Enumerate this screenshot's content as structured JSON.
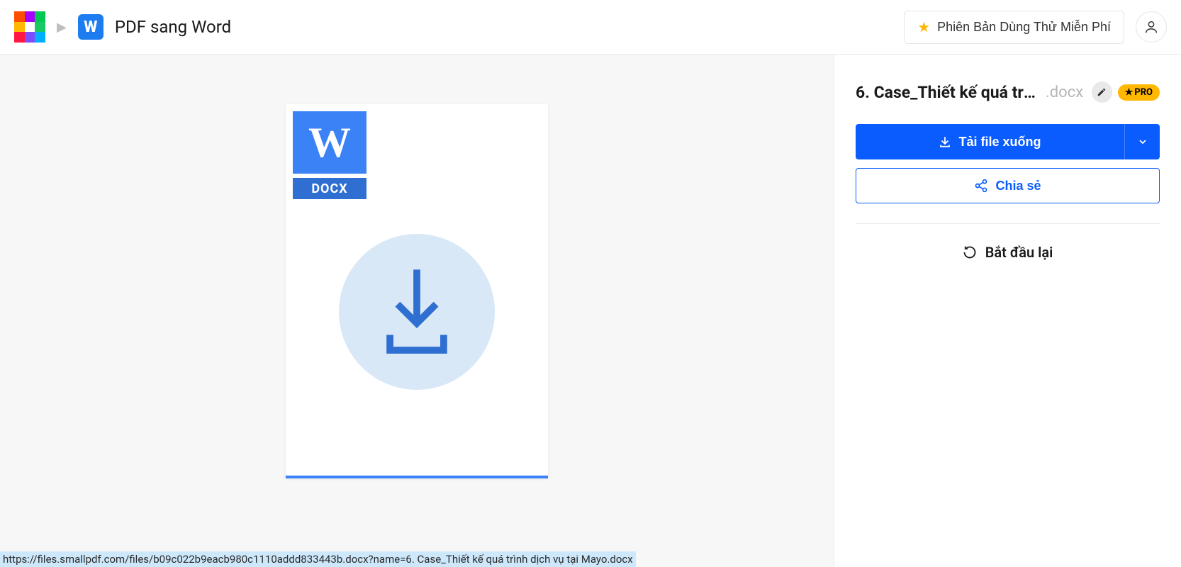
{
  "header": {
    "page_title": "PDF sang Word",
    "trial_label": "Phiên Bản Dùng Thử Miễn Phí"
  },
  "preview": {
    "doc_letter": "W",
    "doc_ext": "DOCX"
  },
  "side": {
    "file_name": "6. Case_Thiết kế quá trìn…",
    "file_ext": ".docx",
    "pro_label": "PRO",
    "download_label": "Tải file xuống",
    "share_label": "Chia sẻ",
    "restart_label": "Bắt đầu lại"
  },
  "status": {
    "url": "https://files.smallpdf.com/files/b09c022b9eacb980c1110addd833443b.docx?name=6. Case_Thiết kế quá trình dịch vụ tại Mayo.docx"
  }
}
